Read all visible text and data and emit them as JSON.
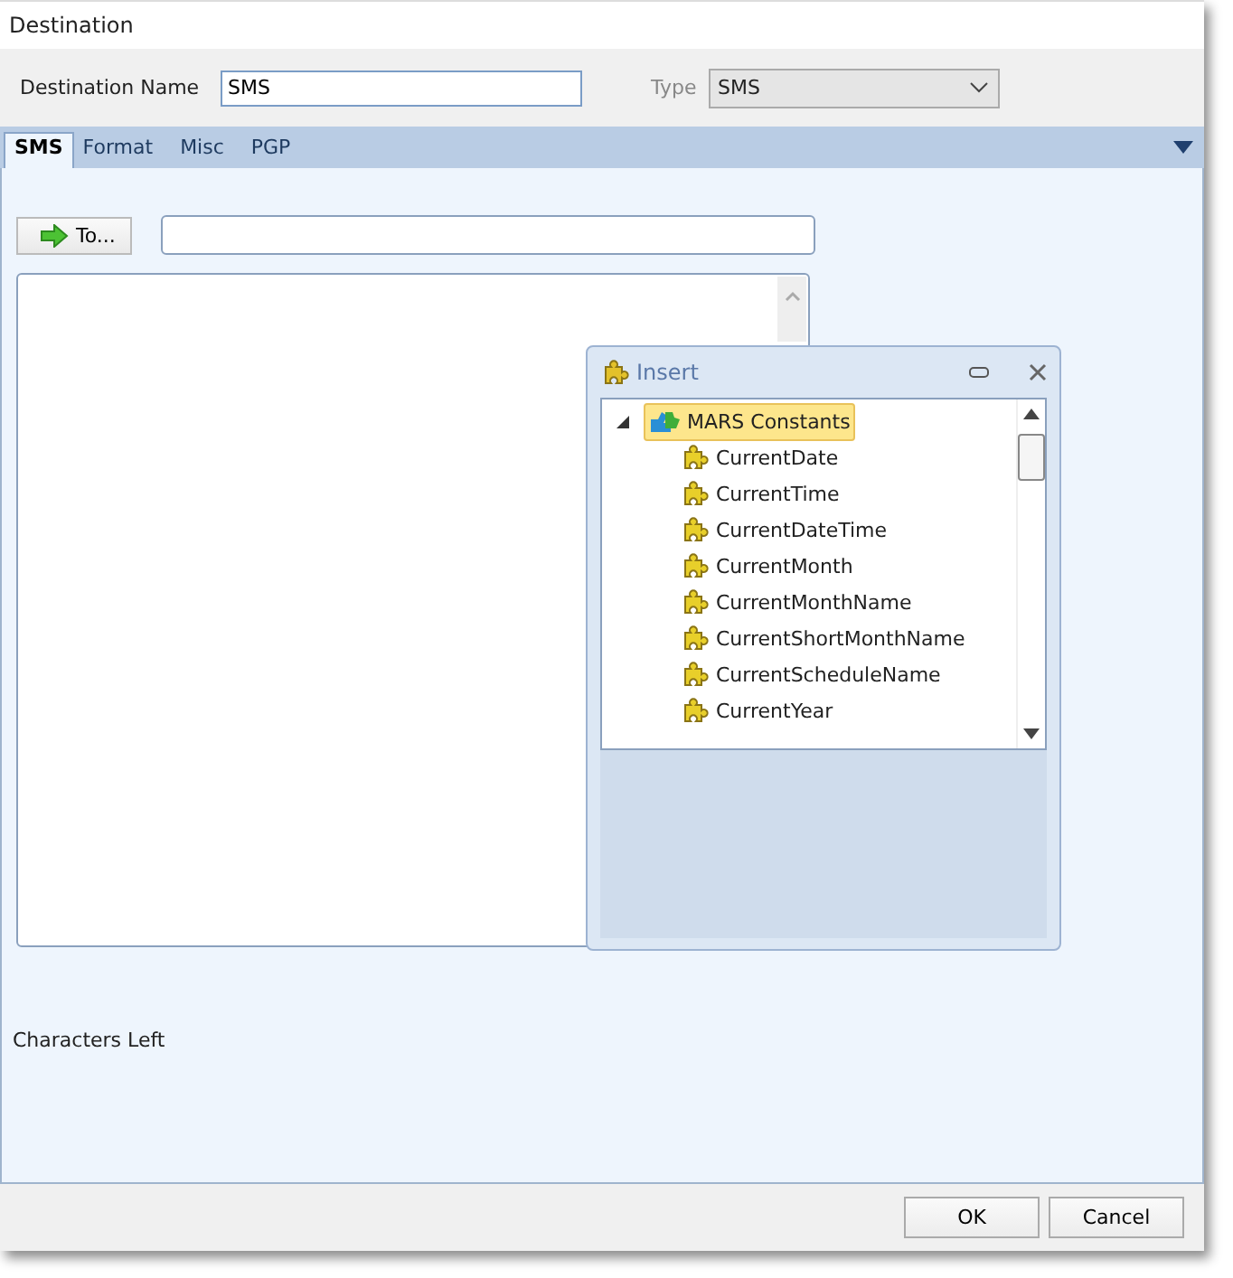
{
  "window": {
    "title": "Destination"
  },
  "header": {
    "name_label": "Destination Name",
    "name_value": "SMS",
    "type_label": "Type",
    "type_value": "SMS"
  },
  "tabs": [
    {
      "label": "SMS",
      "selected": true
    },
    {
      "label": "Format",
      "selected": false
    },
    {
      "label": "Misc",
      "selected": false
    },
    {
      "label": "PGP",
      "selected": false
    }
  ],
  "sms": {
    "to_button": "To...",
    "characters_left_label": "Characters Left"
  },
  "insert_panel": {
    "title": "Insert",
    "tree": [
      {
        "label": "MARS Constants",
        "expanded": true,
        "selected": true,
        "children": [
          {
            "label": "CurrentDate",
            "selected": false
          },
          {
            "label": "CurrentTime",
            "selected": false
          },
          {
            "label": "CurrentDateTime",
            "selected": false
          },
          {
            "label": "CurrentMonth",
            "selected": false
          },
          {
            "label": "CurrentMonthName",
            "selected": false
          },
          {
            "label": "CurrentShortMonthName",
            "selected": false
          },
          {
            "label": "CurrentScheduleName",
            "selected": false
          },
          {
            "label": "CurrentYear",
            "selected": false
          }
        ]
      }
    ]
  },
  "buttons": [
    "OK",
    "Cancel"
  ]
}
